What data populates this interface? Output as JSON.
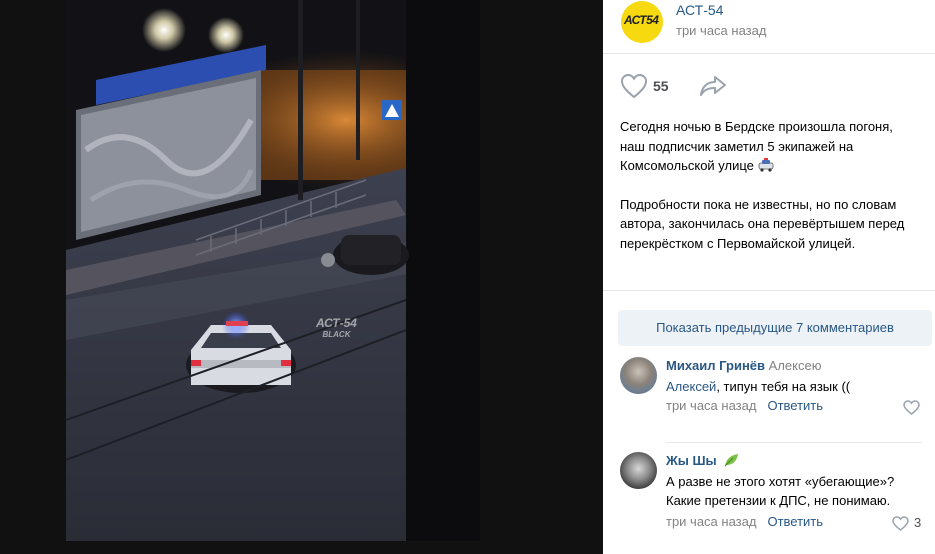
{
  "author": {
    "name": "АСТ-54",
    "time": "три часа назад",
    "avatar_text": "АСТ54"
  },
  "actions": {
    "like_count": "55"
  },
  "post": {
    "paragraph1": "Сегодня ночью в Бердске произошла погоня, наш подписчик заметил 5 экипажей на Комсомольской улице",
    "paragraph2": "Подробности пока не известны, но по словам автора, закончилась она перевёртышем перед перекрёстком с Первомайской улицей."
  },
  "photo": {
    "watermark_line1": "АСТ-54",
    "watermark_line2": "BLACK"
  },
  "comments_header": {
    "show_previous": "Показать предыдущие 7 комментариев"
  },
  "comments": [
    {
      "author": "Михаил Гринёв",
      "reply_to": "Алексею",
      "mention": "Алексей",
      "text": ", типун тебя на язык ((",
      "time": "три часа назад",
      "reply_label": "Ответить",
      "likes": ""
    },
    {
      "author": "Жы Шы",
      "reply_to": "",
      "mention": "",
      "text": "А разве не этого хотят «убегающие»? Какие претензии к ДПС, не понимаю.",
      "time": "три часа назад",
      "reply_label": "Ответить",
      "likes": "3"
    }
  ],
  "colors": {
    "link": "#2a5885",
    "muted": "#828282",
    "avatar_yellow": "#f6d90f",
    "button_bg": "#edf2f7"
  }
}
